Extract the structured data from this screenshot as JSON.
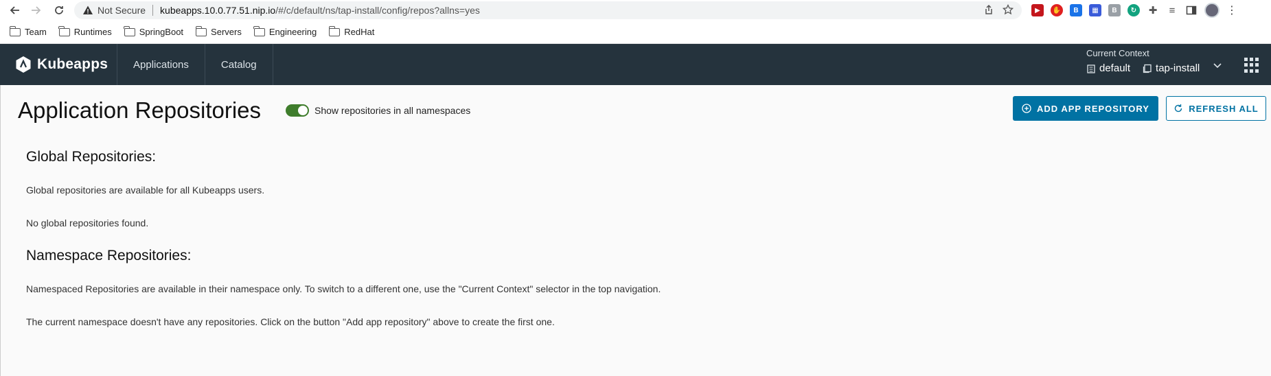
{
  "browser": {
    "security_label": "Not Secure",
    "url_host": "kubeapps.10.0.77.51.nip.io",
    "url_path": "/#/c/default/ns/tap-install/config/repos?allns=yes"
  },
  "bookmarks": [
    "Team",
    "Runtimes",
    "SpringBoot",
    "Servers",
    "Engineering",
    "RedHat"
  ],
  "header": {
    "brand": "Kubeapps",
    "nav": [
      "Applications",
      "Catalog"
    ],
    "context_label": "Current Context",
    "cluster": "default",
    "namespace": "tap-install"
  },
  "page": {
    "title": "Application Repositories",
    "toggle_label": "Show repositories in all namespaces",
    "toggle_on": true,
    "add_button": "ADD APP REPOSITORY",
    "refresh_button": "REFRESH ALL"
  },
  "global": {
    "heading": "Global Repositories:",
    "description": "Global repositories are available for all Kubeapps users.",
    "empty": "No global repositories found."
  },
  "namespace": {
    "heading": "Namespace Repositories:",
    "description": "Namespaced Repositories are available in their namespace only. To switch to a different one, use the \"Current Context\" selector in the top navigation.",
    "empty": "The current namespace doesn't have any repositories. Click on the button \"Add app repository\" above to create the first one."
  },
  "colors": {
    "header_bg": "#25333d",
    "primary": "#0072a3",
    "toggle_on": "#3f7d2c"
  }
}
